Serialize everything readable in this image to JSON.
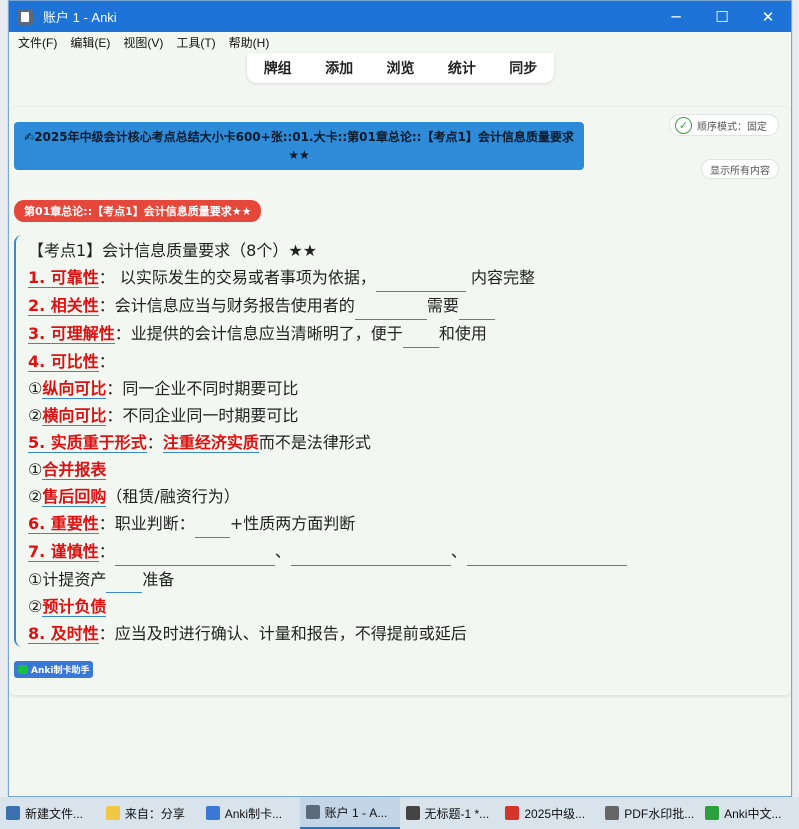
{
  "window": {
    "title": "账户 1 - Anki",
    "controls": [
      "─",
      "☐",
      "✕"
    ]
  },
  "menu": [
    "文件(F)",
    "编辑(E)",
    "视图(V)",
    "工具(T)",
    "帮助(H)"
  ],
  "toolbar": [
    "牌组",
    "添加",
    "浏览",
    "统计",
    "同步"
  ],
  "card": {
    "mode_label": "顺序模式：固定",
    "show_all_label": "显示所有内容",
    "deck_path": "✍2025年中级会计核心考点总结大小卡600+张::01.大卡::第01章总论::【考点1】会计信息质量要求★★",
    "topic_tag": "第01章总论::【考点1】会计信息质量要求★★",
    "lines": {
      "l0": "【考点1】会计信息质量要求（8个）★★",
      "l1_k": "1. 可靠性",
      "l1_a": "：  以实际发生的交易或者事项为依据，",
      "l1_b": " 内容完整",
      "l2_k": "2. 相关性",
      "l2_a": "：会计信息应当与财务报告使用者的",
      "l2_b": "需要",
      "l3_k": "3. 可理解性",
      "l3_a": "：业提供的会计信息应当清晰明了，便于",
      "l3_b": "和使用",
      "l4_k": "4. 可比性",
      "l4_a": "：",
      "l5_p": "①",
      "l5_k": "纵向可比",
      "l5_a": "：同一企业不同时期要可比",
      "l6_p": "②",
      "l6_k": "横向可比",
      "l6_a": "：不同企业同一时期要可比",
      "l7_k": "5. 实质重于形式",
      "l7_a": "：",
      "l7_k2": "注重经济实质",
      "l7_b": "而不是法律形式",
      "l8_p": "①",
      "l8_k": "合并报表",
      "l9_p": "②",
      "l9_k": "售后回购",
      "l9_a": "（租赁/融资行为）",
      "l10_k": "6. 重要性",
      "l10_a": "：职业判断：",
      "l10_b": "+性质两方面判断",
      "l11_k": "7. 谨慎性",
      "l11_a": "：",
      "l11_sep1": "、",
      "l11_sep2": "、",
      "l12_a": "①计提资产",
      "l12_b": "准备",
      "l13_p": "②",
      "l13_k": "预计负债",
      "l14_k": "8. 及时性",
      "l14_a": "：应当及时进行确认、计量和报告，不得提前或延后"
    },
    "helper_label": "Anki制卡助手"
  },
  "taskbar": [
    {
      "label": "新建文件...",
      "color": "#3a6fb0"
    },
    {
      "label": "来自：分享",
      "color": "#f2c744"
    },
    {
      "label": "Anki制卡...",
      "color": "#3a78d8"
    },
    {
      "label": "账户 1 - A...",
      "color": "#5a6a7a",
      "active": true
    },
    {
      "label": "无标题-1 *...",
      "color": "#444"
    },
    {
      "label": "2025中级...",
      "color": "#d6352b"
    },
    {
      "label": "PDF水印批...",
      "color": "#666"
    },
    {
      "label": "Anki中文...",
      "color": "#2aa13a"
    }
  ]
}
